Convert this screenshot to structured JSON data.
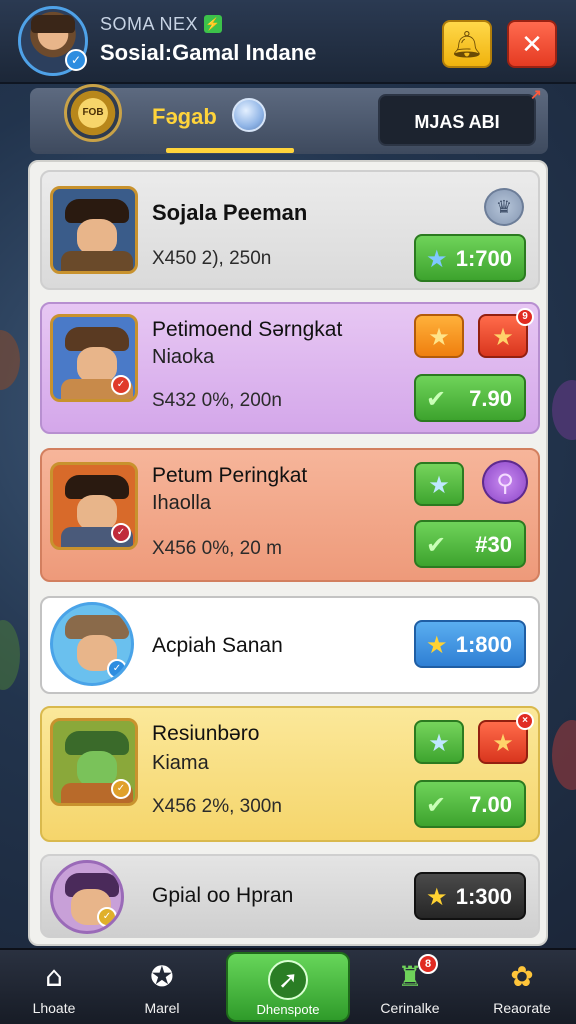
{
  "header": {
    "subtitle": "SOMA NEX",
    "title": "Sosial:Gamal Indane",
    "bolt_icon": "bolt-icon",
    "notification_icon": "bell-icon",
    "close_icon": "close-icon",
    "verified_icon": "verified-check-icon"
  },
  "tabs": {
    "emblem_label": "FOB",
    "active_label": "Fəgab",
    "right_label": "MJAS ABI"
  },
  "cards": [
    {
      "title": "Sojala Peeman",
      "meta": "X450 2), 250n",
      "price": "1:700",
      "price_icon": "star-icon",
      "theme": "gray",
      "action_icon": "crown-icon"
    },
    {
      "title": "Petimoend Sərngkat",
      "subtitle": "Niaoka",
      "meta": "S432 0%, 200n",
      "price": "7.90",
      "price_icon": "arrow-check-icon",
      "theme": "purple",
      "actions": [
        "star-icon",
        "star-icon"
      ],
      "badge": "9"
    },
    {
      "title": "Petum Peringkat",
      "subtitle": "Ihaolla",
      "meta": "X456 0%, 20 m",
      "price": "#30",
      "price_icon": "arrow-check-icon",
      "theme": "orange",
      "actions": [
        "star-icon",
        "magnifier-icon"
      ]
    },
    {
      "title": "Acpiah Sanan",
      "price": "1:800",
      "price_icon": "star-icon",
      "theme": "white"
    },
    {
      "title": "Resiunbəro",
      "subtitle": "Kiama",
      "meta": "X456 2%, 300n",
      "price": "7.00",
      "price_icon": "arrow-check-icon",
      "theme": "yellow",
      "actions": [
        "star-icon",
        "star-icon"
      ],
      "badge": "×"
    },
    {
      "title": "Gpial oo Hpran",
      "price": "1:300",
      "price_icon": "star-icon",
      "theme": "gray"
    }
  ],
  "nav": [
    {
      "label": "Lhoate",
      "icon": "home-icon"
    },
    {
      "label": "Marel",
      "icon": "badge-icon"
    },
    {
      "label": "Dhenspote",
      "icon": "target-icon",
      "active": true
    },
    {
      "label": "Cerinalke",
      "icon": "castle-icon",
      "badge": "8"
    },
    {
      "label": "Reaorate",
      "icon": "flower-icon"
    }
  ],
  "colors": {
    "accent_yellow": "#ffd43b",
    "price_green": "#3da32e",
    "price_blue": "#2f7fd4",
    "close_red": "#e53b22"
  }
}
